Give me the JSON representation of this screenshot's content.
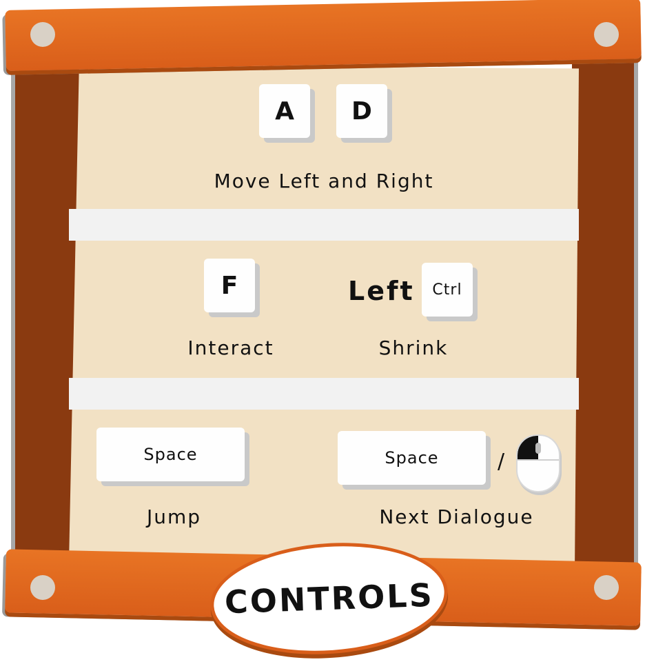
{
  "controls": {
    "row1": {
      "key_a": "A",
      "key_d": "D",
      "label": "Move Left and Right"
    },
    "row2": {
      "key_f": "F",
      "interact_label": "Interact",
      "left_word": "Left",
      "key_ctrl": "Ctrl",
      "shrink_label": "Shrink"
    },
    "row3": {
      "jump_key": "Space",
      "jump_label": "Jump",
      "dialogue_key": "Space",
      "separator": "/",
      "dialogue_label": "Next Dialogue"
    }
  },
  "title": "CONTROLS",
  "icons": {
    "mouse": "mouse-left-click-icon"
  },
  "colors": {
    "wood_dark": "#8a3a10",
    "wood_plank": "#e06a20",
    "board": "#f2e1c4",
    "key": "#fefefe"
  }
}
